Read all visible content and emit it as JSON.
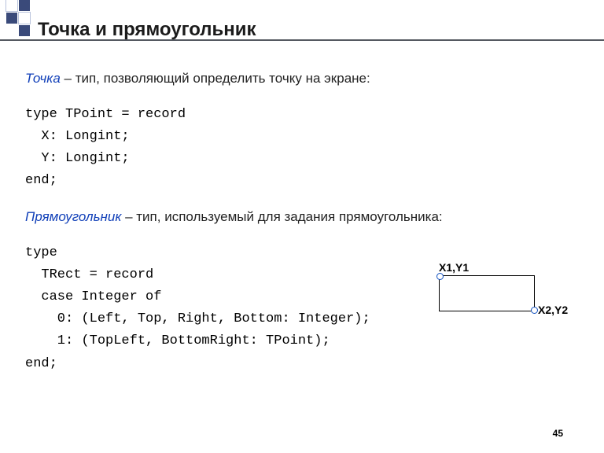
{
  "title": "Точка и прямоугольник",
  "point": {
    "term": "Точка",
    "desc": " – тип, позволяющий определить точку на экране:"
  },
  "point_code": "type TPoint = record\n  X: Longint;\n  Y: Longint;\nend;",
  "rect": {
    "term": "Прямоугольник",
    "desc": " – тип, используемый для задания прямоугольника:"
  },
  "rect_code": "type\n  TRect = record\n  case Integer of\n    0: (Left, Top, Right, Bottom: Integer);\n    1: (TopLeft, BottomRight: TPoint);\nend;",
  "figure": {
    "lbl_tl": "X1,Y1",
    "lbl_br": "X2,Y2"
  },
  "page_number": "45"
}
